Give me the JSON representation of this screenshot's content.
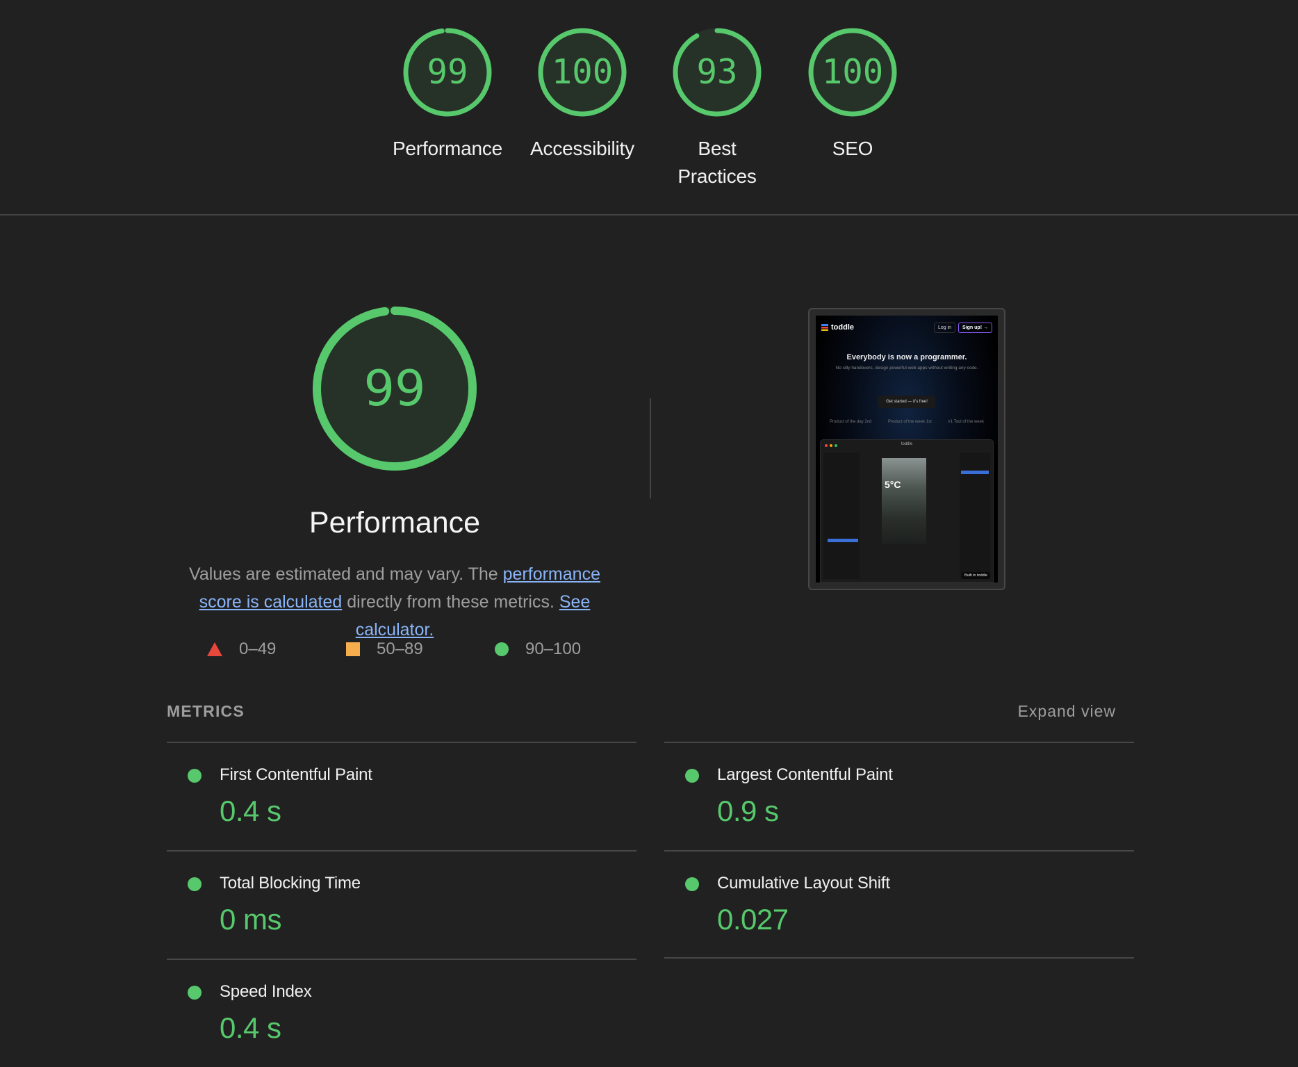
{
  "colors": {
    "pass": "#57c96c",
    "average": "#f5ad4d",
    "fail": "#e8483c",
    "link": "#8ab4f8",
    "background": "#212121",
    "gauge_fill": "#263128"
  },
  "categories": [
    {
      "label": "Performance",
      "score": 99
    },
    {
      "label": "Accessibility",
      "score": 100
    },
    {
      "label": "Best Practices",
      "score": 93
    },
    {
      "label": "SEO",
      "score": 100
    }
  ],
  "summary": {
    "score": 99,
    "title": "Performance",
    "desc_prefix": "Values are estimated and may vary. The ",
    "desc_link1": "performance score is calculated",
    "desc_middle": " directly from these metrics. ",
    "desc_link2": "See calculator.",
    "legend": [
      {
        "icon": "triangle-icon",
        "range": "0–49"
      },
      {
        "icon": "square-icon",
        "range": "50–89"
      },
      {
        "icon": "circle-icon",
        "range": "90–100"
      }
    ]
  },
  "thumbnail": {
    "brand": "toddle",
    "login": "Log in",
    "signup": "Sign up! →",
    "headline": "Everybody is now a programmer.",
    "subline": "No silly handovers, design powerful web apps without writing any code.",
    "cta": "Get started — it's free!",
    "awards": [
      "Product of the day 2nd",
      "Product of the week 1st",
      "#1 Tool of the week"
    ],
    "app_title": "toddle",
    "temperature": "5°C",
    "built_badge": "Built in toddle"
  },
  "metrics": {
    "heading": "METRICS",
    "expand_label": "Expand view",
    "items": [
      {
        "label": "First Contentful Paint",
        "value": "0.4 s",
        "status": "pass"
      },
      {
        "label": "Largest Contentful Paint",
        "value": "0.9 s",
        "status": "pass"
      },
      {
        "label": "Total Blocking Time",
        "value": "0 ms",
        "status": "pass"
      },
      {
        "label": "Cumulative Layout Shift",
        "value": "0.027",
        "status": "pass"
      },
      {
        "label": "Speed Index",
        "value": "0.4 s",
        "status": "pass"
      }
    ]
  }
}
